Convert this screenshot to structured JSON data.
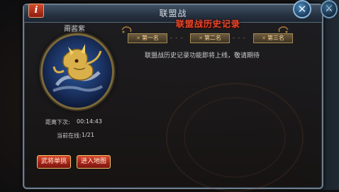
{
  "window": {
    "title": "联盟战",
    "info_icon": "info-icon",
    "close_icon": "close-icon",
    "side_icon": "crossed-swords-icon"
  },
  "guild": {
    "name": "甭酱紫",
    "emblem_icon": "golden-dragon-emblem-icon"
  },
  "status": {
    "timer_label": "距离下次:",
    "timer_value": "00:14:43",
    "online_label": "当前在线:",
    "online_value": "1/21"
  },
  "actions": {
    "duel_label": "武将单挑",
    "enter_map_label": "进入地图"
  },
  "history": {
    "title": "联盟战历史记录",
    "ranks": [
      "第一名",
      "第二名",
      "第三名"
    ],
    "notice": "联盟战历史记录功能即将上线，敬请期待"
  },
  "colors": {
    "accent_red": "#d9492c",
    "title_red": "#e84a2a",
    "gold_border": "#f5c36a"
  }
}
